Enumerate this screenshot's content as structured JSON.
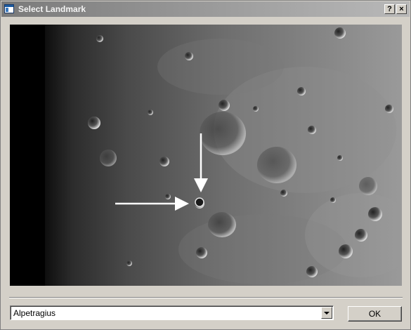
{
  "window": {
    "title": "Select Landmark",
    "help_label": "?",
    "close_label": "×"
  },
  "image": {
    "subject": "moon surface photograph",
    "marked_landmark": "Alpetragius"
  },
  "landmark_select": {
    "value": "Alpetragius"
  },
  "buttons": {
    "ok_label": "OK"
  },
  "icons": {
    "window": "dialog-window-icon",
    "help": "help-icon",
    "close": "close-icon",
    "dropdown": "chevron-down-icon",
    "arrow": "arrow-icon"
  }
}
